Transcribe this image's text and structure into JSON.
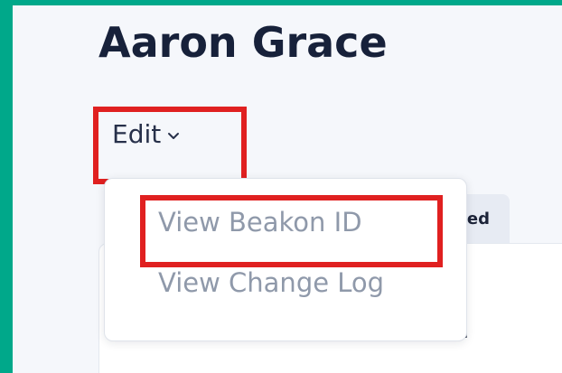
{
  "profile": {
    "name": "Aaron Grace"
  },
  "actions": {
    "edit_label": "Edit"
  },
  "menu": {
    "items": [
      {
        "label": "View Beakon ID"
      },
      {
        "label": "View Change Log"
      }
    ]
  },
  "tabs": {
    "partial_label": "ed"
  },
  "content": {
    "partial_text": "n"
  },
  "colors": {
    "frame": "#00a88a",
    "background": "#f5f7fb",
    "highlight": "#e02020",
    "text_primary": "#17213a",
    "menu_text": "#8f99aa"
  },
  "icons": {
    "edit_dropdown": "chevron-down-icon"
  }
}
